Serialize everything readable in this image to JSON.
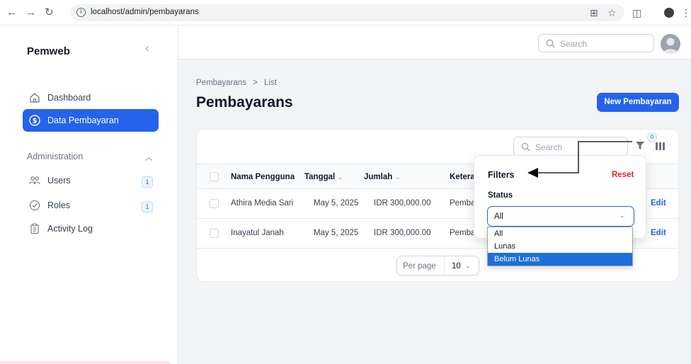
{
  "browser": {
    "url": "localhost/admin/pembayarans",
    "back_icon": "arrow-left-icon",
    "forward_icon": "arrow-right-icon",
    "reload_icon": "reload-icon"
  },
  "sidebar": {
    "brand": "Pemweb",
    "items": [
      {
        "label": "Dashboard",
        "icon": "home-icon",
        "active": false
      },
      {
        "label": "Data Pembayaran",
        "icon": "dollar-circle-icon",
        "active": true
      }
    ],
    "group_label": "Administration",
    "group_items": [
      {
        "label": "Users",
        "icon": "users-icon",
        "badge": "1"
      },
      {
        "label": "Roles",
        "icon": "shield-check-icon",
        "badge": "1"
      },
      {
        "label": "Activity Log",
        "icon": "clipboard-icon",
        "badge": ""
      }
    ]
  },
  "topbar": {
    "search_placeholder": "Search"
  },
  "main": {
    "breadcrumb_root": "Pembayarans",
    "breadcrumb_sep": ">",
    "breadcrumb_current": "List",
    "title": "Pembayarans",
    "new_button": "New Pembayaran"
  },
  "table": {
    "search_placeholder": "Search",
    "filter_count": "0",
    "columns": [
      "Nama Pengguna",
      "Tanggal",
      "Jumlah",
      "Ketera"
    ],
    "rows": [
      {
        "nama": "Athira Media Sari",
        "tanggal": "May 5, 2025",
        "jumlah": "IDR 300,000.00",
        "ket": "Pemba",
        "action": "Edit"
      },
      {
        "nama": "Inayatul Janah",
        "tanggal": "May 5, 2025",
        "jumlah": "IDR 300,000.00",
        "ket": "Pemba",
        "action": "Edit"
      }
    ],
    "per_page_label": "Per page",
    "per_page_value": "10"
  },
  "filters": {
    "title": "Filters",
    "reset": "Reset",
    "status_label": "Status",
    "status_value": "All",
    "options": [
      "All",
      "Lunas",
      "Belum Lunas"
    ],
    "highlighted_option": "Belum Lunas"
  },
  "colors": {
    "primary": "#2563eb",
    "danger": "#dc2626",
    "option_highlight": "#1e6fd9"
  }
}
